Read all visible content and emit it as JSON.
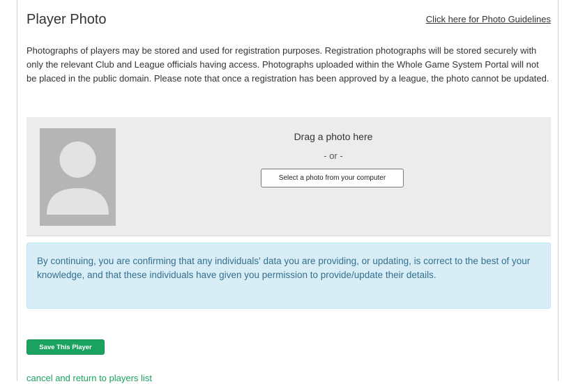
{
  "header": {
    "title": "Player Photo",
    "guidelines_link": "Click here for Photo Guidelines"
  },
  "intro": {
    "text": "Photographs of players may be stored and used for registration purposes. Registration photographs will be stored securely with only the relevant Club and League officials having access. Photographs uploaded within the Whole Game System Portal will not be placed in the public domain. Please note that once a registration has been approved by a league, the photo cannot be updated."
  },
  "photo_upload": {
    "avatar_icon": "person-silhouette-icon",
    "drag_text": "Drag a photo here",
    "or_text": "- or -",
    "select_button": "Select a photo from your computer"
  },
  "notice": {
    "text": "By continuing, you are confirming that any individuals' data you are providing, or updating, is correct to the best of your knowledge, and that these individuals have given you permission to provide/update their details."
  },
  "actions": {
    "save_button": "Save This Player",
    "cancel_link": "cancel and return to players list"
  },
  "colors": {
    "primary_green": "#1aa260",
    "notice_background": "#d9edf7",
    "notice_text": "#31708f",
    "panel_background": "#ececec",
    "avatar_placeholder": "#b5b5b5"
  }
}
